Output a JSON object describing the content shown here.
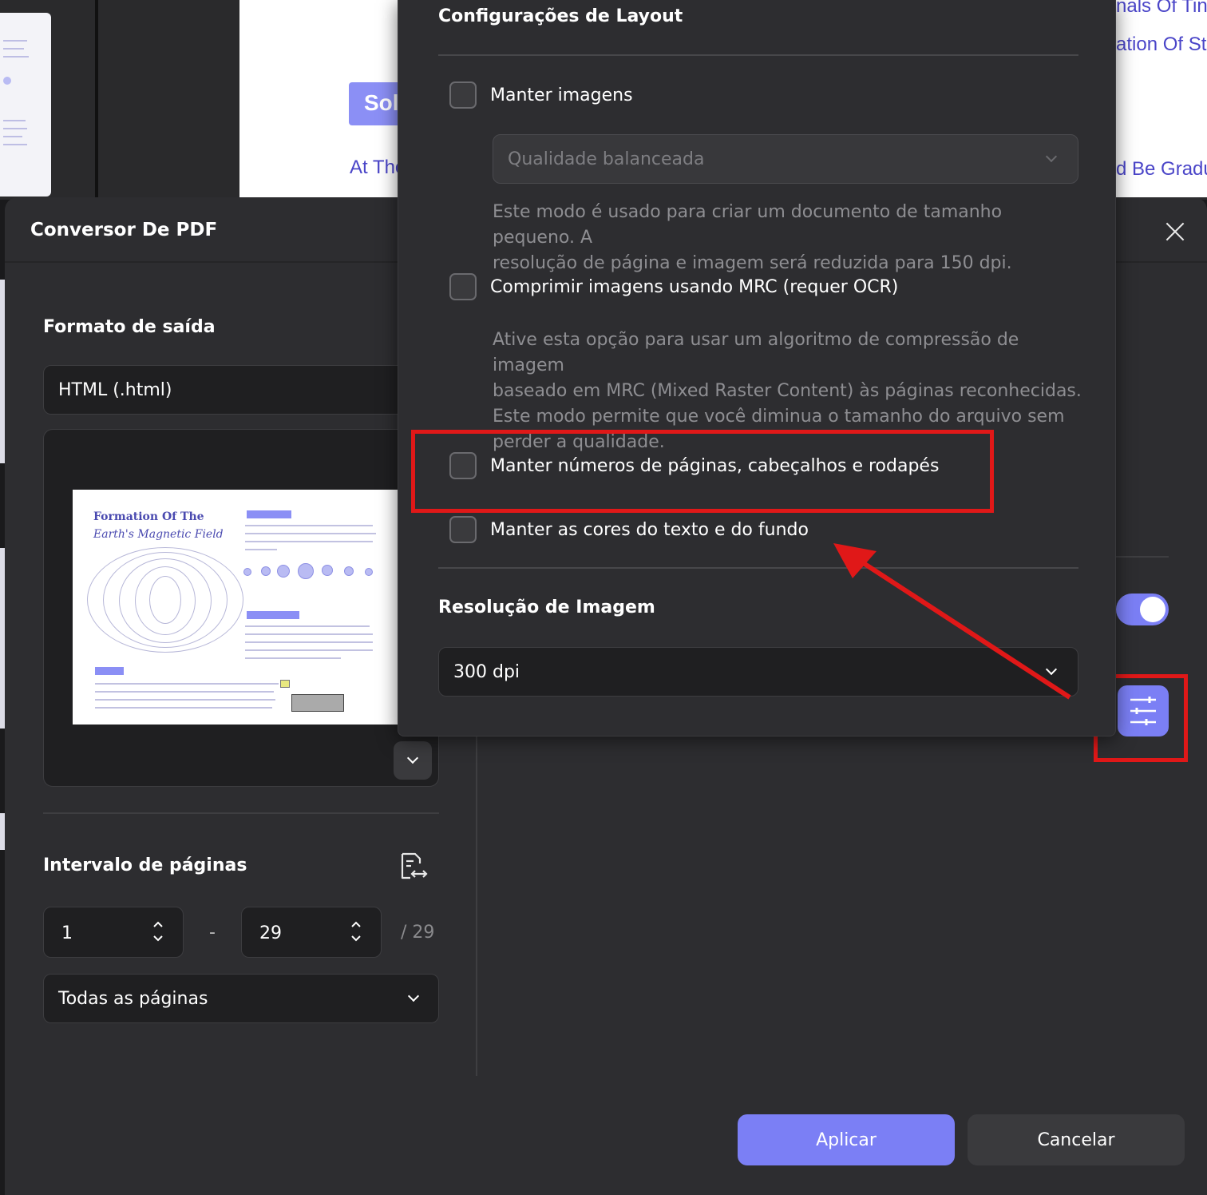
{
  "background": {
    "doc_button_text": "Sol",
    "doc_link_text": "At The",
    "right_lines": [
      "nals Of Tiny",
      "ation Of St",
      "d Be Gradu"
    ]
  },
  "dialog": {
    "title": "Conversor De PDF",
    "output_format": {
      "heading": "Formato de saída",
      "selected": "HTML (.html)"
    },
    "preview": {
      "title_line1": "Formation Of The",
      "title_line2": "Earth's Magnetic Field"
    },
    "page_range": {
      "heading": "Intervalo de páginas",
      "from": "1",
      "separator": "-",
      "to": "29",
      "total": "/ 29",
      "subset": "Todas as páginas"
    },
    "apply_label": "Aplicar",
    "cancel_label": "Cancelar",
    "colors": {
      "accent": "#7b7ff5",
      "highlight": "#e01818",
      "background": "#2d2d30"
    }
  },
  "layout_popup": {
    "title": "Configurações de Layout",
    "keep_images": {
      "label": "Manter imagens",
      "checked": false
    },
    "quality": {
      "selected": "Qualidade balanceada",
      "disabled": true
    },
    "quality_desc": [
      "Este modo é usado para criar um documento de tamanho pequeno. A",
      "resolução de página e imagem será reduzida para 150 dpi."
    ],
    "mrc": {
      "label": "Comprimir imagens usando MRC (requer OCR)",
      "checked": false
    },
    "mrc_desc": [
      "Ative esta opção para usar um algoritmo de compressão de imagem",
      "baseado em MRC (Mixed Raster Content) às páginas reconhecidas.",
      "Este modo permite que você diminua o tamanho do arquivo sem",
      "perder a qualidade."
    ],
    "keep_headers": {
      "label": "Manter números de páginas, cabeçalhos e rodapés",
      "checked": false
    },
    "keep_colors": {
      "label": "Manter as cores do texto e do fundo",
      "checked": false
    },
    "resolution": {
      "heading": "Resolução de Imagem",
      "selected": "300 dpi"
    }
  }
}
